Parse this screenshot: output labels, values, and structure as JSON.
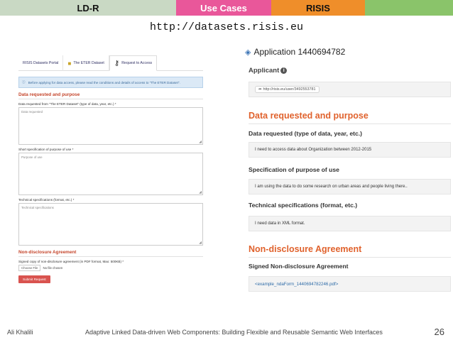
{
  "header": {
    "tabs": [
      {
        "label": "LD-R",
        "color": "#c9d9c4"
      },
      {
        "label": "Use Cases",
        "color": "#e9579a"
      },
      {
        "label": "RISIS",
        "color": "#ef8e2a"
      },
      {
        "label": "",
        "color": "#8ac46a"
      }
    ],
    "url": "http://datasets.risis.eu"
  },
  "form": {
    "tabs": [
      {
        "label": "RISIS Datasets Portal",
        "icon": "none"
      },
      {
        "label": "The ETER Dataset",
        "icon": "folder-icon"
      },
      {
        "label": "Request to Access",
        "icon": "key-icon"
      }
    ],
    "info": "Before applying for data access, please read the conditions and details of access to \"The ETER Dataset\".",
    "section_title": "Data requested and purpose",
    "field1_label": "Data requested from \"The ETER Dataset\" (type of data, year, etc.) *",
    "field1_placeholder": "Data requested",
    "field2_label": "Short specification of purpose of use *",
    "field2_placeholder": "Purpose of use",
    "field3_label": "Technical specifications (format, etc.) *",
    "field3_placeholder": "Technical specifications",
    "nda_title": "Non-disclosure Agreement",
    "nda_label": "Signed copy of non-disclosure agreement (in PDF format, Max: 500KB) *",
    "file_button": "Choose File",
    "file_status": "No file chosen",
    "submit": "Submit Request"
  },
  "application": {
    "title": "Application 1440694782",
    "applicant_label": "Applicant",
    "applicant_uri": "http://risis.eu/user/3492553781",
    "section_title": "Data requested and purpose",
    "data_requested_label": "Data requested (type of data, year, etc.)",
    "data_requested_value": "I need to access data about Organization between 2012-2015",
    "purpose_label": "Specification of purpose of use",
    "purpose_value": "I am using the data to do some research on urban areas and people living there..",
    "tech_label": "Technical specifications (format, etc.)",
    "tech_value": "I need data in XML format.",
    "nda_title": "Non-disclosure Agreement",
    "nda_label": "Signed Non-disclosure Agreement",
    "nda_file": "<example_ndaForm_1440694782246.pdf>"
  },
  "footer": {
    "author": "Ali Khalili",
    "title": "Adaptive Linked Data-driven Web Components: Building Flexible and Reusable Semantic Web Interfaces",
    "page": "26"
  }
}
